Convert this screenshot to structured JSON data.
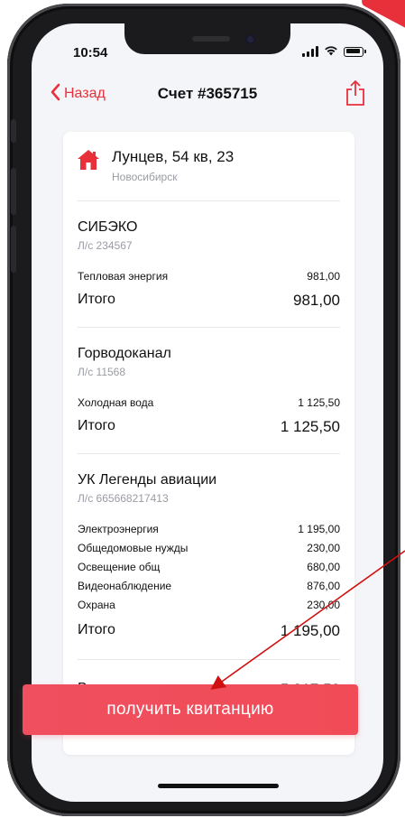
{
  "status_bar": {
    "time": "10:54"
  },
  "nav": {
    "back_label": "Назад",
    "title": "Счет #365715"
  },
  "address": {
    "line": "Лунцев, 54 кв, 23",
    "city": "Новосибирск"
  },
  "providers": [
    {
      "name": "СИБЭКО",
      "account": "Л/с 234567",
      "items": [
        {
          "label": "Тепловая энергия",
          "amount": "981,00"
        }
      ],
      "total_label": "Итого",
      "total": "981,00"
    },
    {
      "name": "Горводоканал",
      "account": "Л/с 11568",
      "items": [
        {
          "label": "Холодная вода",
          "amount": "1 125,50"
        }
      ],
      "total_label": "Итого",
      "total": "1 125,50"
    },
    {
      "name": "УК Легенды авиации",
      "account": "Л/с 665668217413",
      "items": [
        {
          "label": "Электроэнергия",
          "amount": "1 195,00"
        },
        {
          "label": "Общедомовые нужды",
          "amount": "230,00"
        },
        {
          "label": "Освещение общ",
          "amount": "680,00"
        },
        {
          "label": "Видеонаблюдение",
          "amount": "876,00"
        },
        {
          "label": "Охрана",
          "amount": "230,00"
        }
      ],
      "total_label": "Итого",
      "total": "1 195,00"
    }
  ],
  "grand_total": {
    "label": "Всего",
    "value": "5 317,50"
  },
  "cta": {
    "label": "получить квитанцию"
  },
  "colors": {
    "accent": "#e8303b",
    "button": "#ef4f5e",
    "annotation_arrow": "#d01010"
  },
  "icons": {
    "back": "chevron-left-icon",
    "share": "share-icon",
    "address": "home-icon"
  }
}
